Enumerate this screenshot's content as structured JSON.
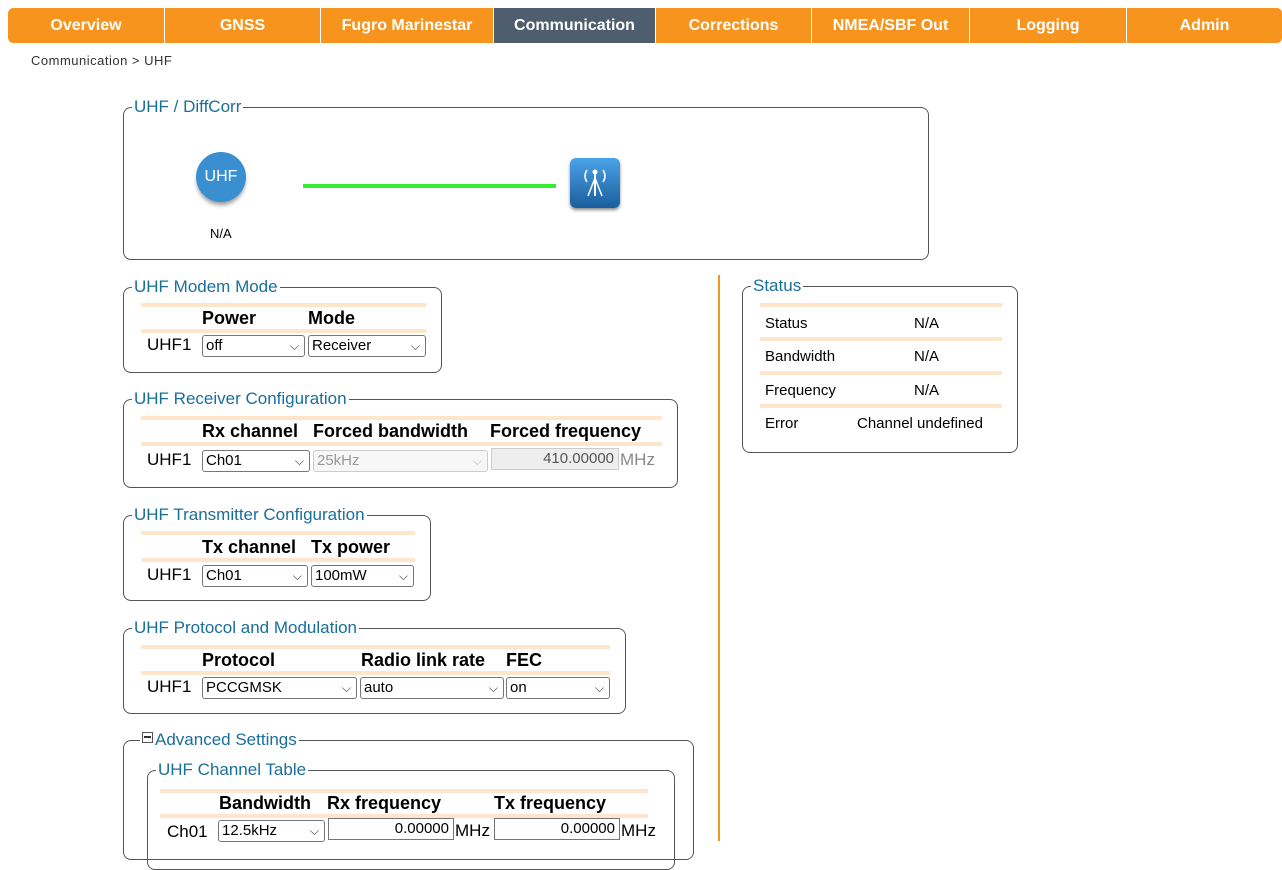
{
  "nav": {
    "tabs": [
      {
        "label": "Overview"
      },
      {
        "label": "GNSS"
      },
      {
        "label": "Fugro Marinestar"
      },
      {
        "label": "Communication"
      },
      {
        "label": "Corrections"
      },
      {
        "label": "NMEA/SBF Out"
      },
      {
        "label": "Logging"
      },
      {
        "label": "Admin"
      }
    ],
    "active_tab": "Communication"
  },
  "breadcrumb": "Communication > UHF",
  "diffcorr": {
    "legend": "UHF / DiffCorr",
    "uhf_icon_text": "UHF",
    "uhf_status": "N/A",
    "link_color": "#33ee33"
  },
  "modem_mode": {
    "legend": "UHF Modem Mode",
    "headers": {
      "power": "Power",
      "mode": "Mode"
    },
    "row_label": "UHF1",
    "power_value": "off",
    "mode_value": "Receiver"
  },
  "receiver": {
    "legend": "UHF Receiver Configuration",
    "headers": {
      "rx_channel": "Rx channel",
      "forced_bandwidth": "Forced bandwidth",
      "forced_frequency": "Forced frequency"
    },
    "row_label": "UHF1",
    "rx_channel": "Ch01",
    "forced_bandwidth": "25kHz",
    "forced_frequency": "410.00000",
    "unit": "MHz"
  },
  "transmitter": {
    "legend": "UHF Transmitter Configuration",
    "headers": {
      "tx_channel": "Tx channel",
      "tx_power": "Tx power"
    },
    "row_label": "UHF1",
    "tx_channel": "Ch01",
    "tx_power": "100mW"
  },
  "protocol": {
    "legend": "UHF Protocol and Modulation",
    "headers": {
      "protocol": "Protocol",
      "radio_link_rate": "Radio link rate",
      "fec": "FEC"
    },
    "row_label": "UHF1",
    "protocol": "PCCGMSK",
    "radio_link_rate": "auto",
    "fec": "on"
  },
  "advanced": {
    "legend": "Advanced Settings",
    "channel_table": {
      "legend": "UHF Channel Table",
      "headers": {
        "bandwidth": "Bandwidth",
        "rx_frequency": "Rx frequency",
        "tx_frequency": "Tx frequency"
      },
      "rows": [
        {
          "label": "Ch01",
          "bandwidth": "12.5kHz",
          "rx_frequency": "0.00000",
          "tx_frequency": "0.00000",
          "unit": "MHz"
        }
      ]
    }
  },
  "status": {
    "legend": "Status",
    "rows": [
      {
        "label": "Status",
        "value": "N/A"
      },
      {
        "label": "Bandwidth",
        "value": "N/A"
      },
      {
        "label": "Frequency",
        "value": "N/A"
      },
      {
        "label": "Error",
        "value": "Channel undefined"
      }
    ]
  },
  "colors": {
    "nav_orange": "#f7941e",
    "nav_active": "#4f5e6f",
    "legend_blue": "#1a6e9a",
    "divider_orange": "#f7941e"
  }
}
